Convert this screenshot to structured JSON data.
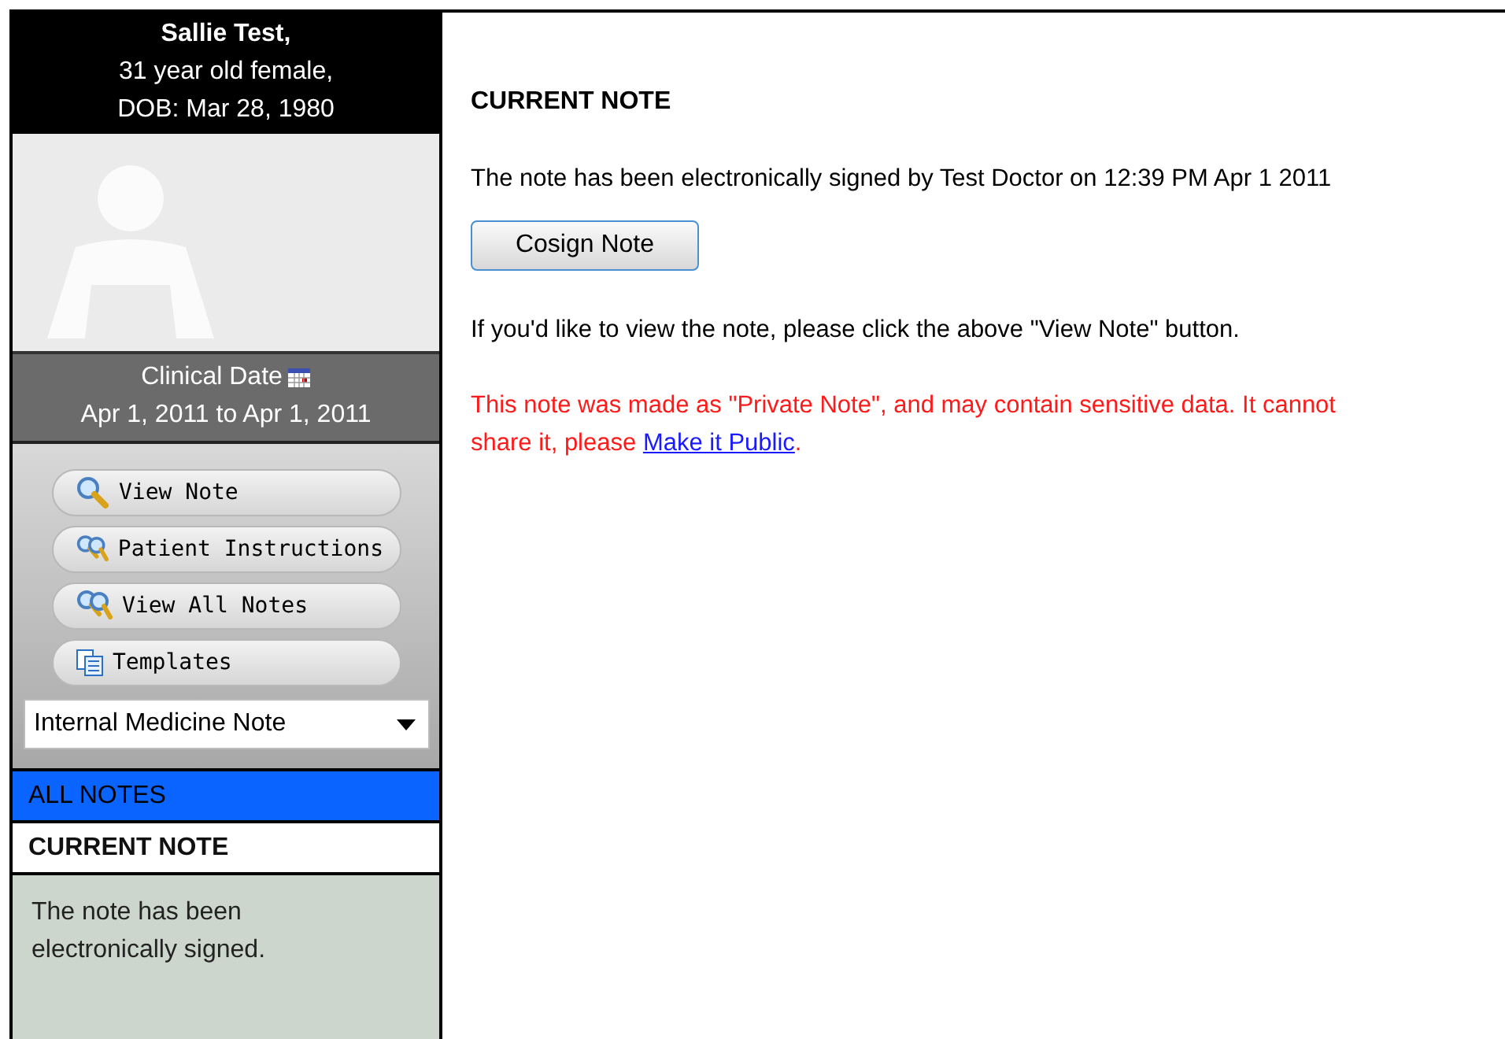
{
  "patient": {
    "name": "Sallie Test,",
    "age_sex": "31 year old female,",
    "dob": "DOB: Mar 28, 1980"
  },
  "clinical_date": {
    "label": "Clinical Date",
    "range": "Apr 1, 2011 to Apr 1, 2011"
  },
  "actions": [
    {
      "label": "View Note",
      "kind": "search"
    },
    {
      "label": "Patient Instructions",
      "kind": "multi-search"
    },
    {
      "label": "View All Notes",
      "kind": "multi-search"
    },
    {
      "label": "Templates",
      "kind": "templates"
    }
  ],
  "template_select": {
    "value": "Internal Medicine Note"
  },
  "nav": [
    {
      "label": "ALL NOTES",
      "selected": true
    },
    {
      "label": "CURRENT NOTE",
      "selected": false
    }
  ],
  "sidebar_status": "The note has been electronically signed.",
  "main": {
    "heading": "CURRENT NOTE",
    "signed_text": "The note has been electronically signed by Test Doctor on 12:39 PM Apr 1 2011",
    "cosign_button": "Cosign Note",
    "hint": "If you'd like to view  the note, please click the above \"View  Note\" button.",
    "warning_line1": "This note was made as \"Private Note\", and may contain sensitive data. It cannot",
    "warning_line2": "share it, please ",
    "warning_link": "Make it Public",
    "warning_end": "."
  }
}
